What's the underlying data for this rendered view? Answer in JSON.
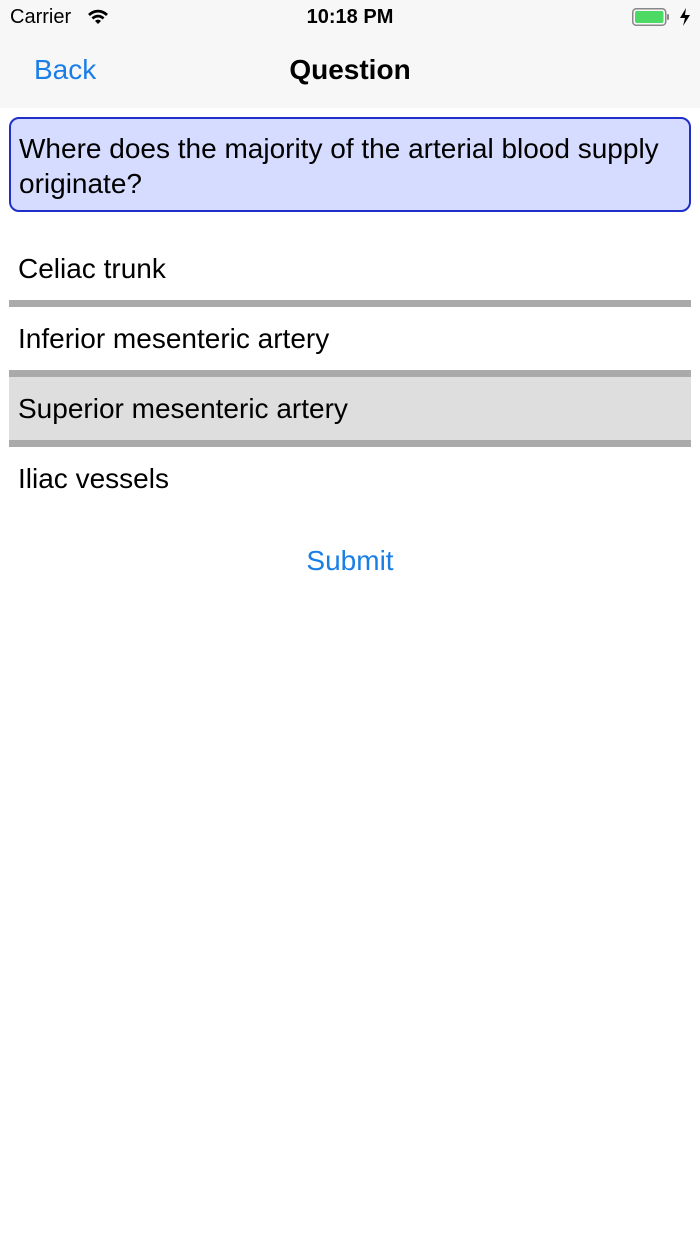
{
  "status_bar": {
    "carrier": "Carrier",
    "time": "10:18 PM",
    "icons": [
      "wifi-icon",
      "battery-icon",
      "charging-bolt-icon"
    ],
    "battery_color": "#4cd964"
  },
  "nav": {
    "back_label": "Back",
    "title": "Question"
  },
  "question": {
    "text": "Where does the majority of the arterial blood supply originate?"
  },
  "answers": [
    {
      "label": "Celiac trunk",
      "selected": false
    },
    {
      "label": "Inferior mesenteric artery",
      "selected": false
    },
    {
      "label": "Superior mesenteric artery",
      "selected": true
    },
    {
      "label": "Iliac vessels",
      "selected": false
    }
  ],
  "submit_label": "Submit",
  "colors": {
    "accent": "#1a7ee6",
    "question_bg": "#d6dcff",
    "question_border": "#1f2fc8",
    "selected_bg": "#dedede",
    "divider": "#aaaaaa"
  }
}
